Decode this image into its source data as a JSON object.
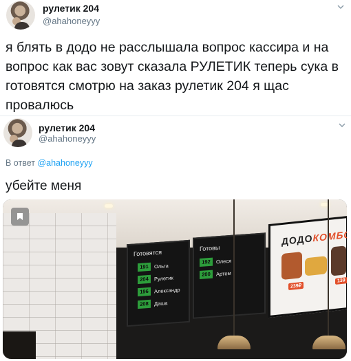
{
  "tweet1": {
    "author_name": "рулетик 204",
    "author_handle": "@ahahoneyyy",
    "text": "я блять в додо не расслышала вопрос кассира и на вопрос как вас зовут сказала РУЛЕТИК теперь сука в готовятся смотрю на заказ рулетик 204 я щас провалюсь"
  },
  "tweet2": {
    "author_name": "рулетик 204",
    "author_handle": "@ahahoneyyy",
    "reply_prefix": "В ответ",
    "reply_handle": "@ahahoneyyy",
    "text": "убейте меня"
  },
  "photo": {
    "board_left": {
      "title": "Готовятся",
      "orders": [
        {
          "num": "191",
          "name": "Ольга"
        },
        {
          "num": "204",
          "name": "Рулетик"
        },
        {
          "num": "196",
          "name": "Александр"
        },
        {
          "num": "208",
          "name": "Даша"
        }
      ]
    },
    "board_right": {
      "title": "Готовы",
      "orders": [
        {
          "num": "192",
          "name": "Олеся"
        },
        {
          "num": "200",
          "name": "Артем"
        }
      ]
    },
    "promo_logo_main": "ДОДО",
    "promo_logo_accent": "КОМБО",
    "promo_price_1": "239₽",
    "promo_price_2": "139"
  },
  "icons": {
    "chevron": "chevron-down-icon",
    "bookmark": "bookmark-icon"
  },
  "colors": {
    "link": "#1da1f2",
    "secondary_text": "#657786",
    "order_badge": "#2d9d3b",
    "brand_accent": "#e2502b"
  }
}
